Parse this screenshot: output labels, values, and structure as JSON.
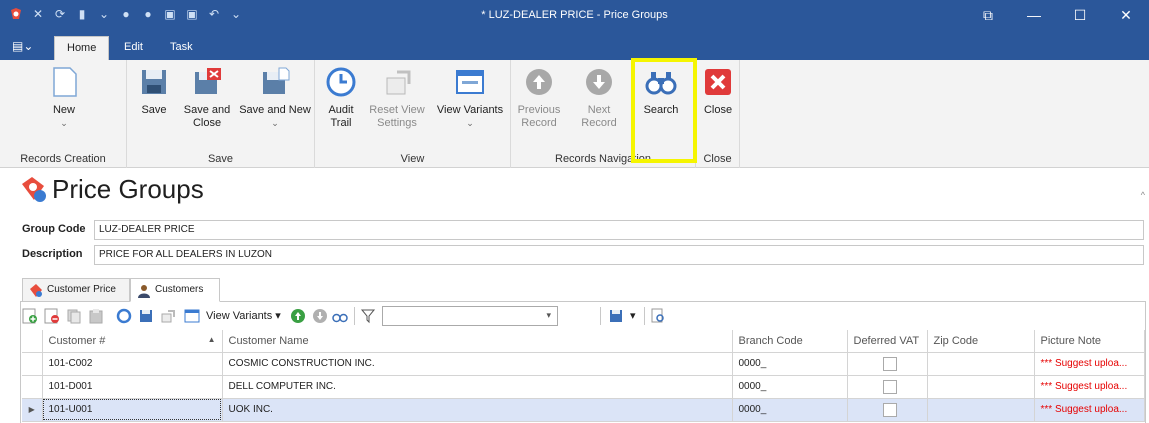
{
  "window": {
    "title": "* LUZ-DEALER PRICE - Price Groups",
    "controls": {
      "restore": "⧉",
      "minimize": "—",
      "maximize": "☐",
      "close": "✕"
    }
  },
  "ribbon_tabs": [
    "Home",
    "Edit",
    "Task"
  ],
  "ribbon": {
    "groups": {
      "records_creation": "Records Creation",
      "save": "Save",
      "view": "View",
      "records_navigation": "Records Navigation",
      "close": "Close"
    },
    "buttons": {
      "new": "New",
      "save": "Save",
      "save_and_close_1": "Save and",
      "save_and_close_2": "Close",
      "save_and_new": "Save and New",
      "audit_trail_1": "Audit",
      "audit_trail_2": "Trail",
      "reset_view_1": "Reset View",
      "reset_view_2": "Settings",
      "view_variants": "View Variants",
      "previous_1": "Previous",
      "previous_2": "Record",
      "next": "Next Record",
      "search": "Search",
      "close": "Close"
    },
    "chevron": "⌄"
  },
  "page": {
    "title": "Price Groups"
  },
  "form": {
    "group_code_label": "Group Code",
    "group_code_value": "LUZ-DEALER PRICE",
    "description_label": "Description",
    "description_value": "PRICE FOR ALL DEALERS IN LUZON"
  },
  "tabs": [
    "Customer Price",
    "Customers"
  ],
  "grid_toolbar": {
    "view_variants": "View Variants"
  },
  "grid": {
    "columns": [
      "Customer #",
      "Customer Name",
      "Branch Code",
      "Deferred VAT",
      "Zip Code",
      "Picture Note"
    ],
    "rows": [
      {
        "customer_no": "101-C002",
        "name": "COSMIC CONSTRUCTION INC.",
        "branch": "0000_",
        "deferred_vat": false,
        "zip": "",
        "note": "*** Suggest uploa..."
      },
      {
        "customer_no": "101-D001",
        "name": "DELL COMPUTER INC.",
        "branch": "0000_",
        "deferred_vat": false,
        "zip": "",
        "note": "*** Suggest uploa..."
      },
      {
        "customer_no": "101-U001",
        "name": "UOK INC.",
        "branch": "0000_",
        "deferred_vat": false,
        "zip": "",
        "note": "*** Suggest uploa..."
      }
    ]
  },
  "colors": {
    "titlebar": "#2b579a",
    "highlight": "#f5f500",
    "note_red": "#e60000",
    "selected_row": "#dbe4f7"
  }
}
